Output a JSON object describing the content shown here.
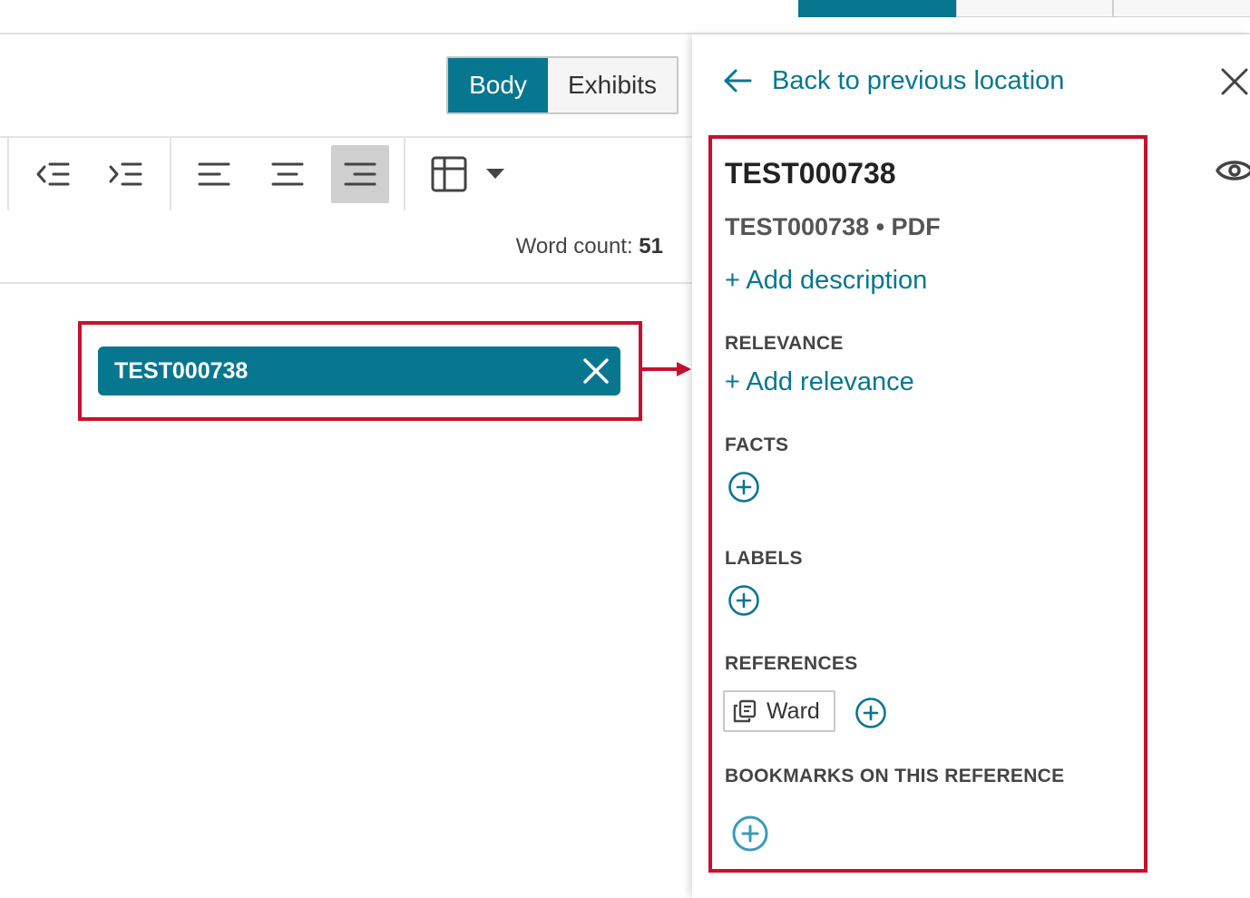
{
  "editor": {
    "view_toggle": {
      "body_label": "Body",
      "exhibits_label": "Exhibits"
    },
    "word_count": {
      "label": "Word count:",
      "value": "51"
    },
    "exhibit_chip": {
      "label": "TEST000738"
    }
  },
  "side_panel": {
    "back_label": "Back to previous location",
    "title": "TEST000738",
    "subtitle": "TEST000738 • PDF",
    "add_description": "+ Add description",
    "relevance": {
      "heading": "RELEVANCE",
      "add_label": "+ Add relevance"
    },
    "facts": {
      "heading": "FACTS"
    },
    "labels": {
      "heading": "LABELS"
    },
    "references": {
      "heading": "REFERENCES",
      "items": [
        {
          "label": "Ward"
        }
      ]
    },
    "bookmarks": {
      "heading": "BOOKMARKS ON THIS REFERENCE"
    }
  },
  "colors": {
    "accent": "#077790",
    "highlight": "#c8102e",
    "pressed": "#cfcfcf"
  }
}
